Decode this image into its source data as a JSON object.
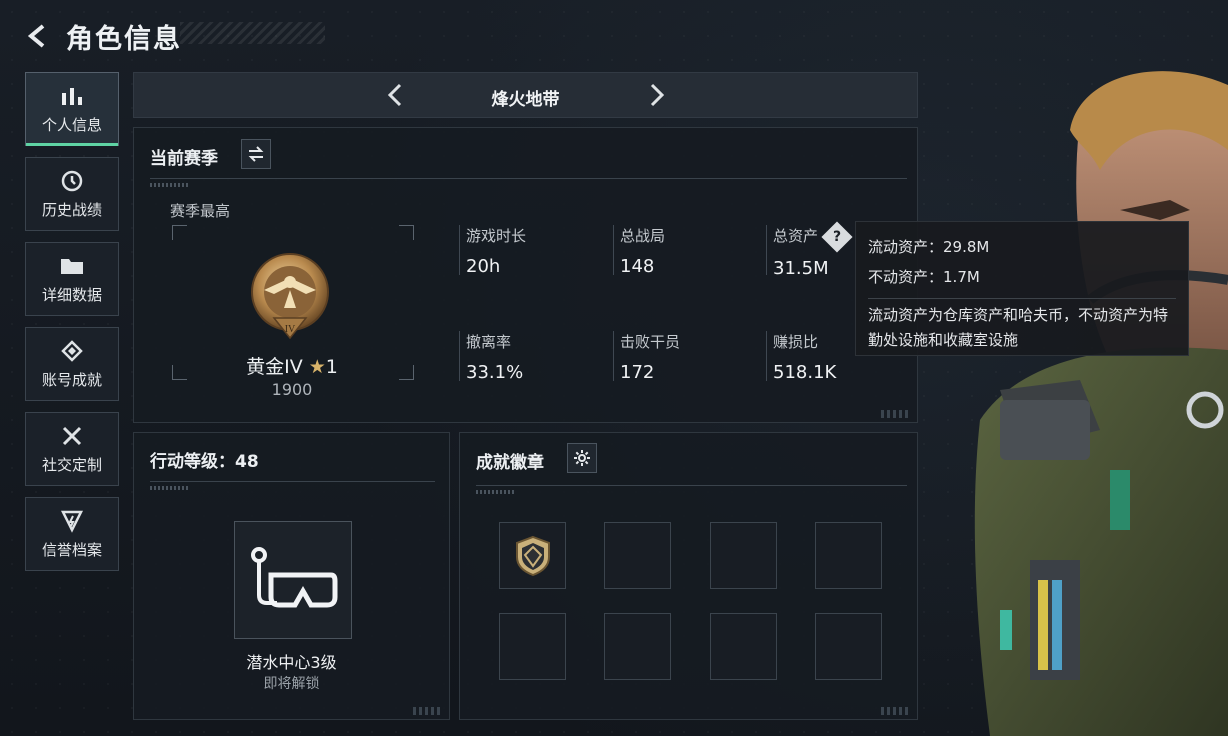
{
  "header": {
    "title": "角色信息"
  },
  "sidebar": {
    "items": [
      {
        "label": "个人信息",
        "icon": "bar-chart-icon",
        "active": true
      },
      {
        "label": "历史战绩",
        "icon": "history-clock-icon"
      },
      {
        "label": "详细数据",
        "icon": "folder-icon"
      },
      {
        "label": "账号成就",
        "icon": "achievement-icon"
      },
      {
        "label": "社交定制",
        "icon": "tools-icon"
      },
      {
        "label": "信誉档案",
        "icon": "credit-shield-icon"
      }
    ]
  },
  "mode": {
    "name": "烽火地带"
  },
  "season": {
    "header": "当前赛季",
    "best_label": "赛季最高",
    "rank_name": "黄金IV",
    "rank_stars": "1",
    "rank_score": "1900",
    "stats": [
      {
        "label": "游戏时长",
        "value": "20h"
      },
      {
        "label": "总战局",
        "value": "148"
      },
      {
        "label": "总资产",
        "value": "31.5M"
      },
      {
        "label": "撤离率",
        "value": "33.1%"
      },
      {
        "label": "击败干员",
        "value": "172"
      },
      {
        "label": "赚损比",
        "value": "518.1K"
      }
    ]
  },
  "action": {
    "header_label": "行动等级：",
    "level": "48",
    "unlock_name": "潜水中心3级",
    "unlock_status": "即将解锁"
  },
  "badges": {
    "header": "成就徽章"
  },
  "tooltip": {
    "liquid_label": "流动资产：",
    "liquid_value": "29.8M",
    "fixed_label": "不动资产：",
    "fixed_value": "1.7M",
    "note": "流动资产为仓库资产和哈夫币，不动资产为特勤处设施和收藏室设施"
  },
  "colors": {
    "accent": "#5fd3a4",
    "gold": "#d8b36a"
  }
}
